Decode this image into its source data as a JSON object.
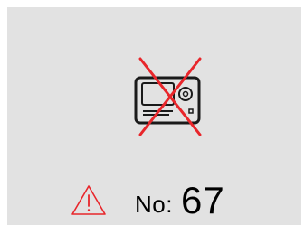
{
  "status_icon": "no-storage-device-icon",
  "warning_icon": "warning-triangle-icon",
  "error": {
    "label": "No:",
    "code": "67"
  },
  "colors": {
    "background": "#e2e2e2",
    "icon_stroke": "#1a1a1a",
    "cross": "#e8262b",
    "warning": "#e8262b",
    "text": "#000000"
  }
}
